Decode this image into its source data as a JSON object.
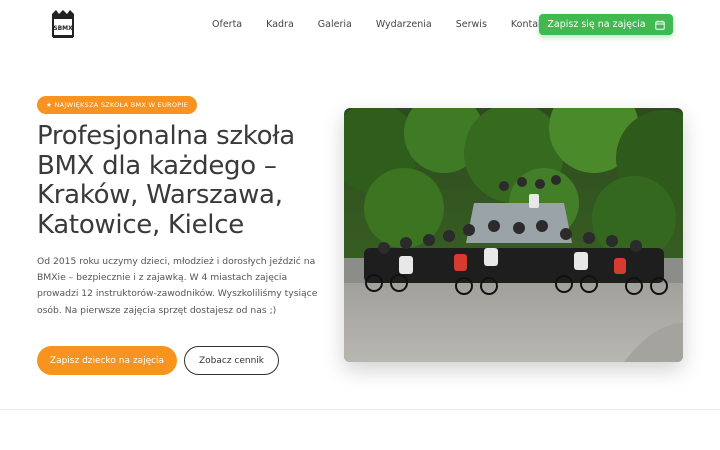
{
  "logo": {
    "icon": "bmx-school-logo"
  },
  "nav": {
    "items": [
      "Oferta",
      "Kadra",
      "Galeria",
      "Wydarzenia",
      "Serwis",
      "Kontakt"
    ]
  },
  "header_cta": {
    "label": "Zapisz się na zajęcia",
    "icon": "calendar-icon",
    "color": "#3fb950"
  },
  "hero": {
    "badge": "★ NAJWIĘKSZA SZKOŁA BMX W EUROPIE",
    "title": "Profesjonalna szkoła BMX dla każdego – Kraków, Warszawa, Katowice, Kielce",
    "description": "Od 2015 roku uczymy dzieci, młodzież i dorosłych jeździć na BMXie – bezpiecznie i z zajawką. W 4 miastach zajęcia prowadzi 12 instruktorów-zawodników. Wyszkoliliśmy tysiące osób. Na pierwsze zajęcia sprzęt dostajesz od nas ;)",
    "primary_button": "Zapisz dziecko na zajęcia",
    "secondary_button": "Zobacz cennik",
    "accent_color": "#f7931e"
  },
  "photo": {
    "icon": "group-photo-bmx-riders"
  }
}
